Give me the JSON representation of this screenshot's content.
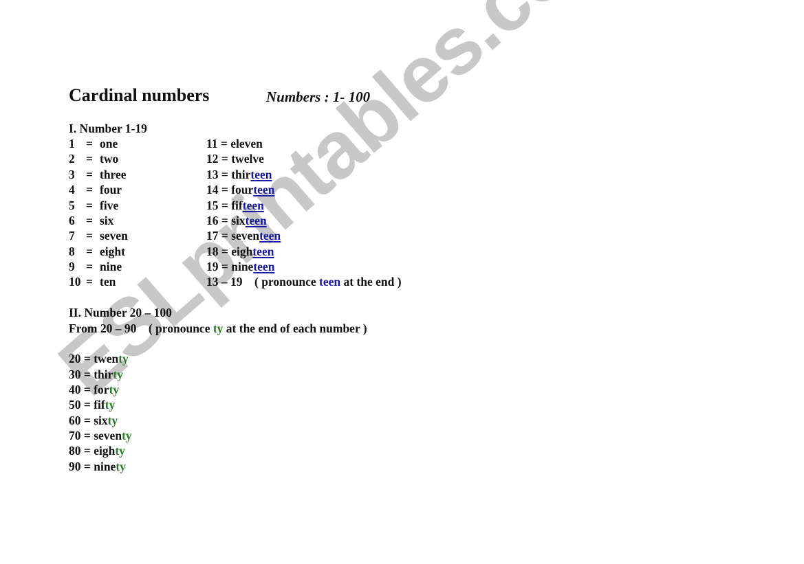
{
  "watermark": "ESLprintables.com",
  "title": "Cardinal numbers",
  "subtitle": "Numbers :  1- 100",
  "section1": {
    "heading": "I. Number 1-19",
    "left": [
      {
        "num": "1",
        "eq": "=",
        "word": "one"
      },
      {
        "num": "2",
        "eq": "=",
        "word": "two"
      },
      {
        "num": "3",
        "eq": "=",
        "word": "three"
      },
      {
        "num": "4",
        "eq": "=",
        "word": "four"
      },
      {
        "num": "5",
        "eq": "=",
        "word": "five"
      },
      {
        "num": "6",
        "eq": "=",
        "word": "six"
      },
      {
        "num": "7",
        "eq": "=",
        "word": "seven"
      },
      {
        "num": "8",
        "eq": "=",
        "word": "eight"
      },
      {
        "num": "9",
        "eq": "=",
        "word": "nine"
      },
      {
        "num": "10",
        "eq": "=",
        "word": "ten"
      }
    ],
    "right": [
      {
        "prefix": "11 = eleven",
        "suffix": ""
      },
      {
        "prefix": "12 = twelve",
        "suffix": ""
      },
      {
        "prefix": "13 = thir",
        "suffix": "teen"
      },
      {
        "prefix": "14 = four",
        "suffix": "teen"
      },
      {
        "prefix": "15 = fif",
        "suffix": "teen"
      },
      {
        "prefix": "16 = six",
        "suffix": "teen"
      },
      {
        "prefix": "17 = seven",
        "suffix": "teen"
      },
      {
        "prefix": "18 = eigh",
        "suffix": "teen"
      },
      {
        "prefix": "19 = nine",
        "suffix": "teen"
      }
    ],
    "note": {
      "before": "13 – 19    ( pronounce ",
      "highlight": "teen",
      "after": " at the end )"
    }
  },
  "section2": {
    "heading": "II. Number 20 – 100",
    "note": {
      "before": "From 20 – 90    ( pronounce ",
      "highlight": "ty",
      "after": " at the end of each number )"
    },
    "items": [
      {
        "prefix": "20 = twen",
        "suffix": "ty"
      },
      {
        "prefix": "30 = thir",
        "suffix": "ty"
      },
      {
        "prefix": "40 = for",
        "suffix": "ty"
      },
      {
        "prefix": "50 = fif",
        "suffix": "ty"
      },
      {
        "prefix": "60 = six",
        "suffix": "ty"
      },
      {
        "prefix": "70 = seven",
        "suffix": "ty"
      },
      {
        "prefix": "80 = eigh",
        "suffix": "ty"
      },
      {
        "prefix": "90 = nine",
        "suffix": "ty"
      }
    ]
  },
  "colors": {
    "teen": "#1a1aa0",
    "ty": "#2a7a2a",
    "watermark": "#c8c8c8"
  }
}
